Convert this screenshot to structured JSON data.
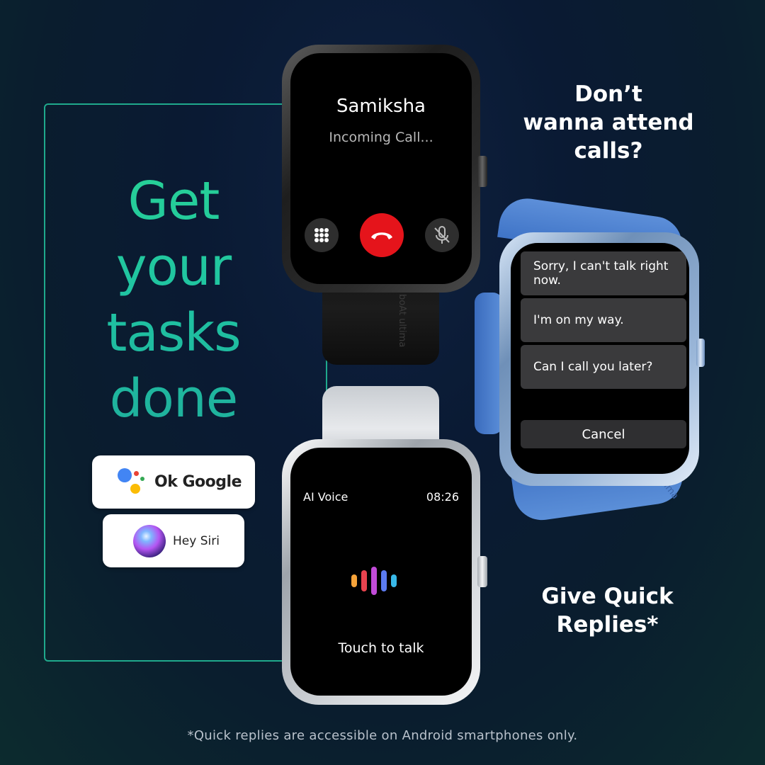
{
  "headline": {
    "line1": "Get",
    "line2": "your",
    "line3": "tasks",
    "line4": "done"
  },
  "assistants": {
    "google_label": "Ok Google",
    "siri_label": "Hey Siri"
  },
  "call_prompt": {
    "line1": "Don’t",
    "line2": "wanna attend",
    "line3": "calls?"
  },
  "replies_prompt": {
    "line1": "Give Quick",
    "line2": "Replies*"
  },
  "footnote": "*Quick replies are accessible on Android smartphones only.",
  "watch_call": {
    "caller_name": "Samiksha",
    "status": "Incoming Call...",
    "strap_brand": "boAt ultima"
  },
  "watch_replies": {
    "items": [
      "Sorry, I can't talk right now.",
      "I'm on my way.",
      "Can I call you later?"
    ],
    "cancel_label": "Cancel",
    "strap_brand": "boAt ultima"
  },
  "watch_voice": {
    "title": "AI Voice",
    "time": "08:26",
    "prompt": "Touch to talk"
  },
  "colors": {
    "accent_green": "#1fc3a2",
    "decline_red": "#e5141b",
    "strap_blue": "#4a7fd0"
  }
}
